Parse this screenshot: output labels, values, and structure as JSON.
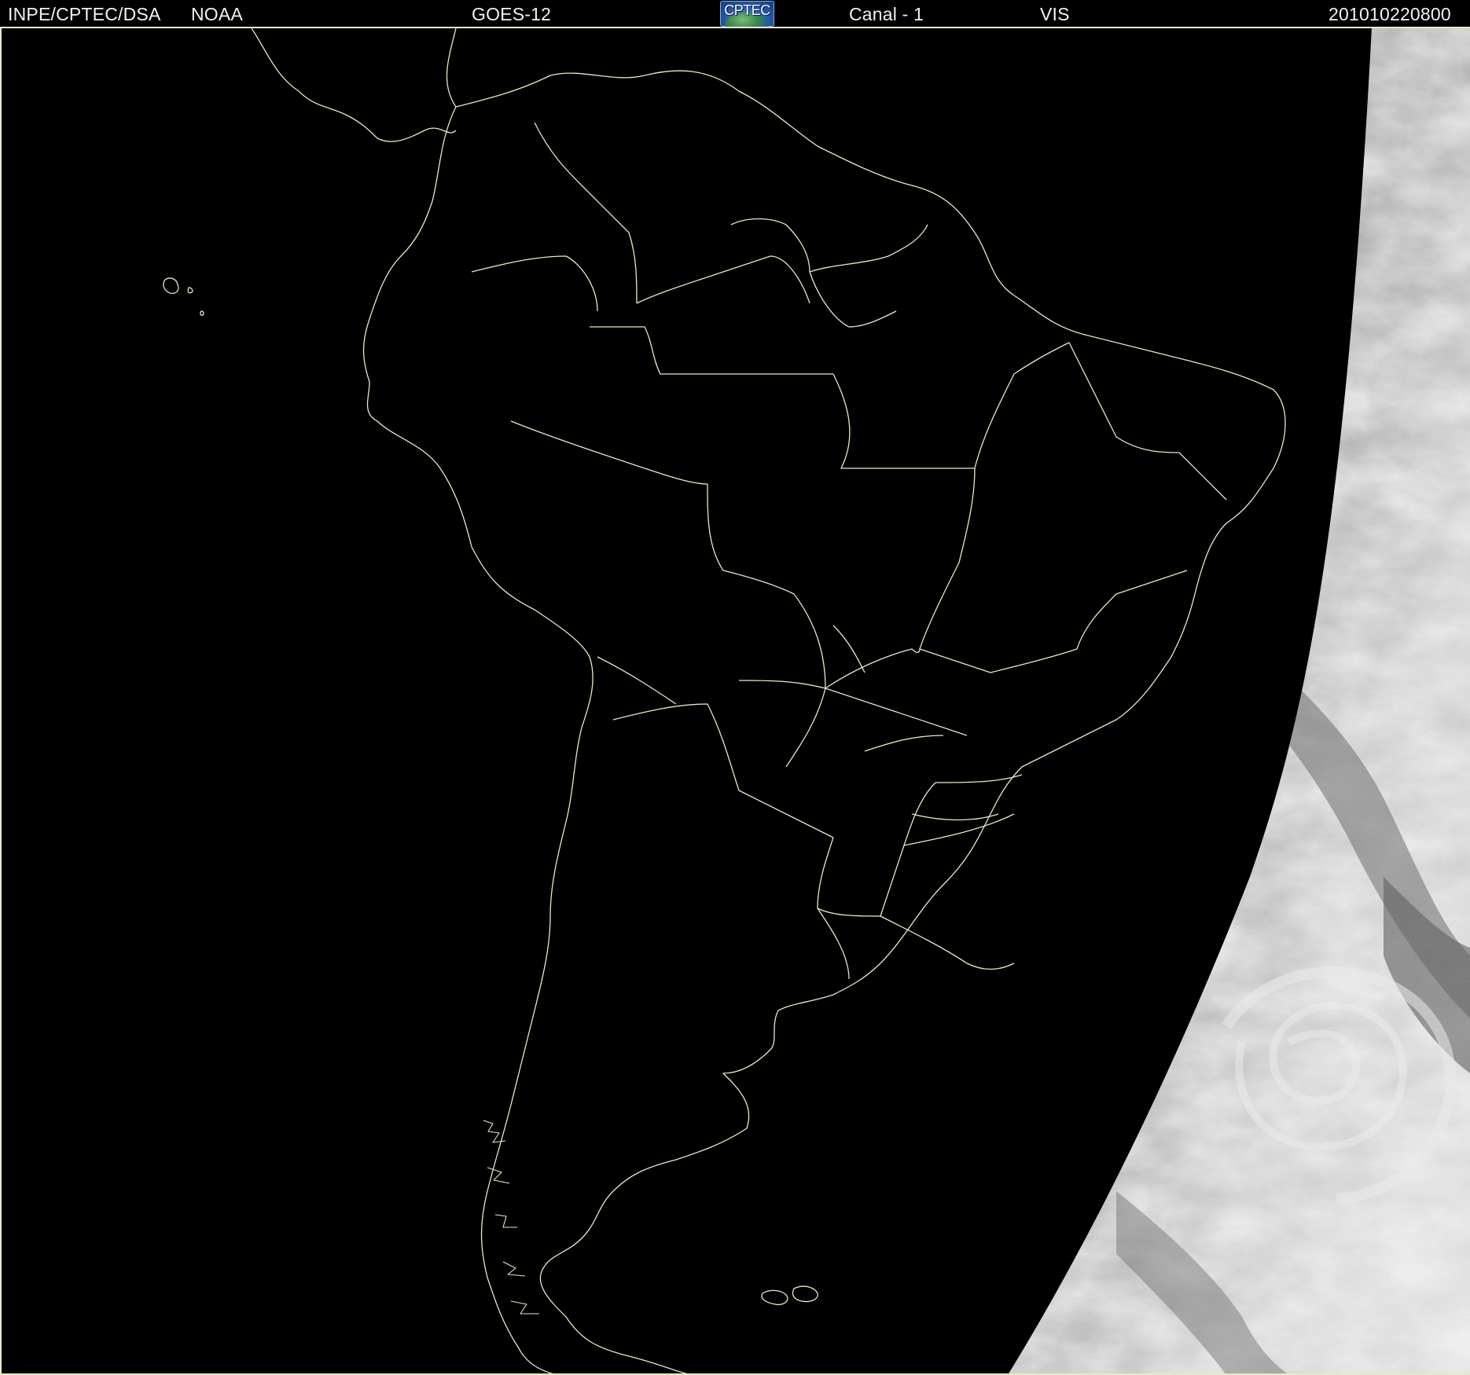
{
  "header": {
    "agency": "INPE/CPTEC/DSA",
    "provider": "NOAA",
    "satellite": "GOES-12",
    "logo_text": "CPTEC",
    "channel": "Canal - 1",
    "band": "VIS",
    "timestamp": "201010220800"
  },
  "map": {
    "coastline_color": "#e9e8c8",
    "ocean_color": "#000000",
    "cloud_gray": "#9a9a9a",
    "cloud_bright": "#e6e6e6"
  }
}
